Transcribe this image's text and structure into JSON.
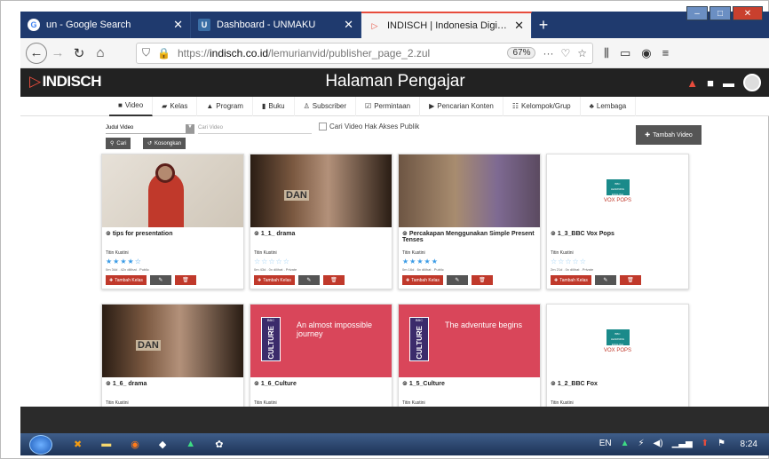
{
  "browser": {
    "tabs": [
      {
        "title": "un - Google Search",
        "icon": "google-icon"
      },
      {
        "title": "Dashboard - UNMAKU",
        "icon": "unmaku-icon"
      },
      {
        "title": "INDISCH | Indonesia Digital Sch",
        "icon": "indisch-icon"
      }
    ],
    "close_glyph": "✕",
    "new_tab": "+",
    "url_prefix": "https://",
    "url_domain": "indisch.co.id",
    "url_path": "/lemurianvid/publisher_page_2.zul",
    "zoom": "67%",
    "more": "···"
  },
  "app": {
    "logo": "INDISCH",
    "page_title": "Halaman Pengajar",
    "menu": [
      {
        "label": "Video",
        "icon": "video-icon"
      },
      {
        "label": "Kelas",
        "icon": "class-icon"
      },
      {
        "label": "Program",
        "icon": "program-icon"
      },
      {
        "label": "Buku",
        "icon": "book-icon"
      },
      {
        "label": "Subscriber",
        "icon": "subscriber-icon"
      },
      {
        "label": "Permintaan",
        "icon": "request-icon"
      },
      {
        "label": "Pencarian Konten",
        "icon": "content-search-icon"
      },
      {
        "label": "Kelompok/Grup",
        "icon": "group-icon"
      },
      {
        "label": "Lembaga",
        "icon": "institution-icon"
      }
    ]
  },
  "filters": {
    "select_value": "Judul Video",
    "search_placeholder": "Cari Video",
    "checkbox_label": "Cari Video Hak Akses Publik",
    "search_button": "Cari",
    "reset_button": "Kosongkan",
    "add_video_button": "Tambah Video"
  },
  "card_actions": {
    "add_class": "Tambah Kelas"
  },
  "cards": [
    {
      "title": "tips for presentation",
      "author": "Titin Kustini",
      "rating": 4,
      "meta": "0m 34d . 42x dilihat . Public",
      "thumb": "class"
    },
    {
      "title": "1_1_ drama",
      "author": "Titin Kustini",
      "rating": 0,
      "meta": "0m 43d . 0x dilihat . Private",
      "thumb": "drama"
    },
    {
      "title": "Percakapan Menggunakan Simple Present Tenses",
      "author": "Titin Kustini",
      "rating": 5,
      "meta": "0m 16d . 6x dilihat . Public",
      "thumb": "convo"
    },
    {
      "title": "1_3_BBC Vox Pops",
      "author": "Titin Kustini",
      "rating": 0,
      "meta": "2m 21d . 0x dilihat . Private",
      "thumb": "bbc"
    },
    {
      "title": "1_6_ drama",
      "author": "Titin Kustini",
      "thumb": "drama"
    },
    {
      "title": "1_6_Culture",
      "author": "Titin Kustini",
      "thumb": "culture",
      "culture_text": "An almost impossible journey"
    },
    {
      "title": "1_5_Culture",
      "author": "Titin Kustini",
      "thumb": "culture",
      "culture_text": "The adventure begins"
    },
    {
      "title": "1_2_BBC Fox",
      "author": "Titin Kustini",
      "thumb": "bbc"
    }
  ],
  "thumb_labels": {
    "dan": "DAN",
    "vox_pops": "VOX POPS",
    "bbc": "BBC",
    "culture": "CULTURE",
    "learning_english": "LEARNING ENGLISH"
  },
  "taskbar": {
    "lang": "EN",
    "clock": "8:24"
  }
}
